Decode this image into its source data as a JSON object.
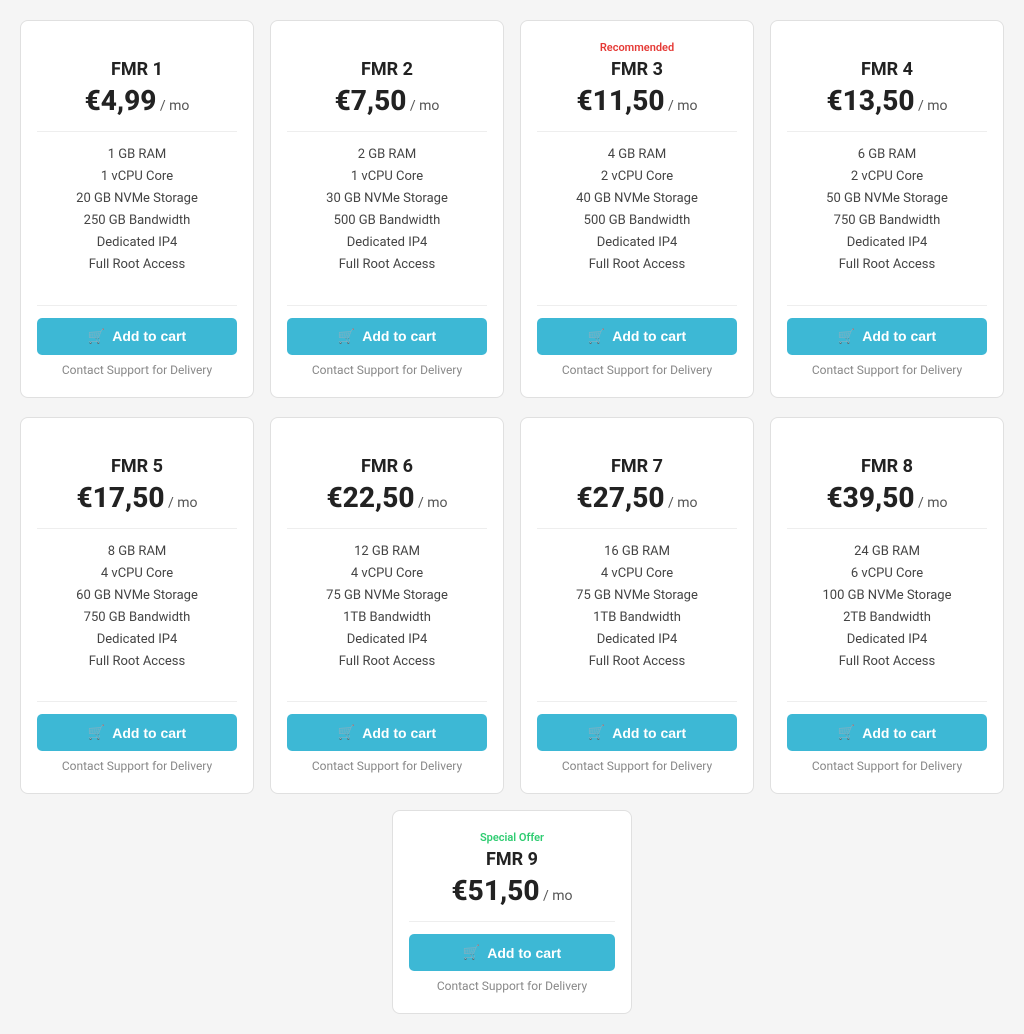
{
  "cards": [
    {
      "id": "fmr1",
      "name": "FMR 1",
      "badge": "",
      "badge_type": "",
      "price": "€4,99",
      "unit": "/ mo",
      "features": [
        "1 GB RAM",
        "1 vCPU Core",
        "20 GB NVMe Storage",
        "250 GB Bandwidth",
        "Dedicated IP4",
        "Full Root Access"
      ],
      "btn_label": "Add to cart",
      "contact": "Contact Support for Delivery"
    },
    {
      "id": "fmr2",
      "name": "FMR 2",
      "badge": "",
      "badge_type": "",
      "price": "€7,50",
      "unit": "/ mo",
      "features": [
        "2 GB RAM",
        "1 vCPU Core",
        "30 GB NVMe Storage",
        "500 GB Bandwidth",
        "Dedicated IP4",
        "Full Root Access"
      ],
      "btn_label": "Add to cart",
      "contact": "Contact Support for Delivery"
    },
    {
      "id": "fmr3",
      "name": "FMR 3",
      "badge": "Recommended",
      "badge_type": "recommended",
      "price": "€11,50",
      "unit": "/ mo",
      "features": [
        "4 GB RAM",
        "2 vCPU Core",
        "40 GB NVMe Storage",
        "500 GB Bandwidth",
        "Dedicated IP4",
        "Full Root Access"
      ],
      "btn_label": "Add to cart",
      "contact": "Contact Support for Delivery"
    },
    {
      "id": "fmr4",
      "name": "FMR 4",
      "badge": "",
      "badge_type": "",
      "price": "€13,50",
      "unit": "/ mo",
      "features": [
        "6 GB RAM",
        "2 vCPU Core",
        "50 GB NVMe Storage",
        "750 GB Bandwidth",
        "Dedicated IP4",
        "Full Root Access"
      ],
      "btn_label": "Add to cart",
      "contact": "Contact Support for Delivery"
    },
    {
      "id": "fmr5",
      "name": "FMR 5",
      "badge": "",
      "badge_type": "",
      "price": "€17,50",
      "unit": "/ mo",
      "features": [
        "8 GB RAM",
        "4 vCPU Core",
        "60 GB NVMe Storage",
        "750 GB Bandwidth",
        "Dedicated IP4",
        "Full Root Access"
      ],
      "btn_label": "Add to cart",
      "contact": "Contact Support for Delivery"
    },
    {
      "id": "fmr6",
      "name": "FMR 6",
      "badge": "",
      "badge_type": "",
      "price": "€22,50",
      "unit": "/ mo",
      "features": [
        "12 GB RAM",
        "4 vCPU Core",
        "75 GB NVMe Storage",
        "1TB Bandwidth",
        "Dedicated IP4",
        "Full Root Access"
      ],
      "btn_label": "Add to cart",
      "contact": "Contact Support for Delivery"
    },
    {
      "id": "fmr7",
      "name": "FMR 7",
      "badge": "",
      "badge_type": "",
      "price": "€27,50",
      "unit": "/ mo",
      "features": [
        "16 GB RAM",
        "4 vCPU Core",
        "75 GB NVMe Storage",
        "1TB Bandwidth",
        "Dedicated IP4",
        "Full Root Access"
      ],
      "btn_label": "Add to cart",
      "contact": "Contact Support for Delivery"
    },
    {
      "id": "fmr8",
      "name": "FMR 8",
      "badge": "",
      "badge_type": "",
      "price": "€39,50",
      "unit": "/ mo",
      "features": [
        "24 GB RAM",
        "6 vCPU Core",
        "100 GB NVMe Storage",
        "2TB Bandwidth",
        "Dedicated IP4",
        "Full Root Access"
      ],
      "btn_label": "Add to cart",
      "contact": "Contact Support for Delivery"
    },
    {
      "id": "fmr9",
      "name": "FMR 9",
      "badge": "Special Offer",
      "badge_type": "special",
      "price": "€51,50",
      "unit": "/ mo",
      "features": [],
      "btn_label": "Add to cart",
      "contact": "Contact Support for Delivery"
    }
  ]
}
